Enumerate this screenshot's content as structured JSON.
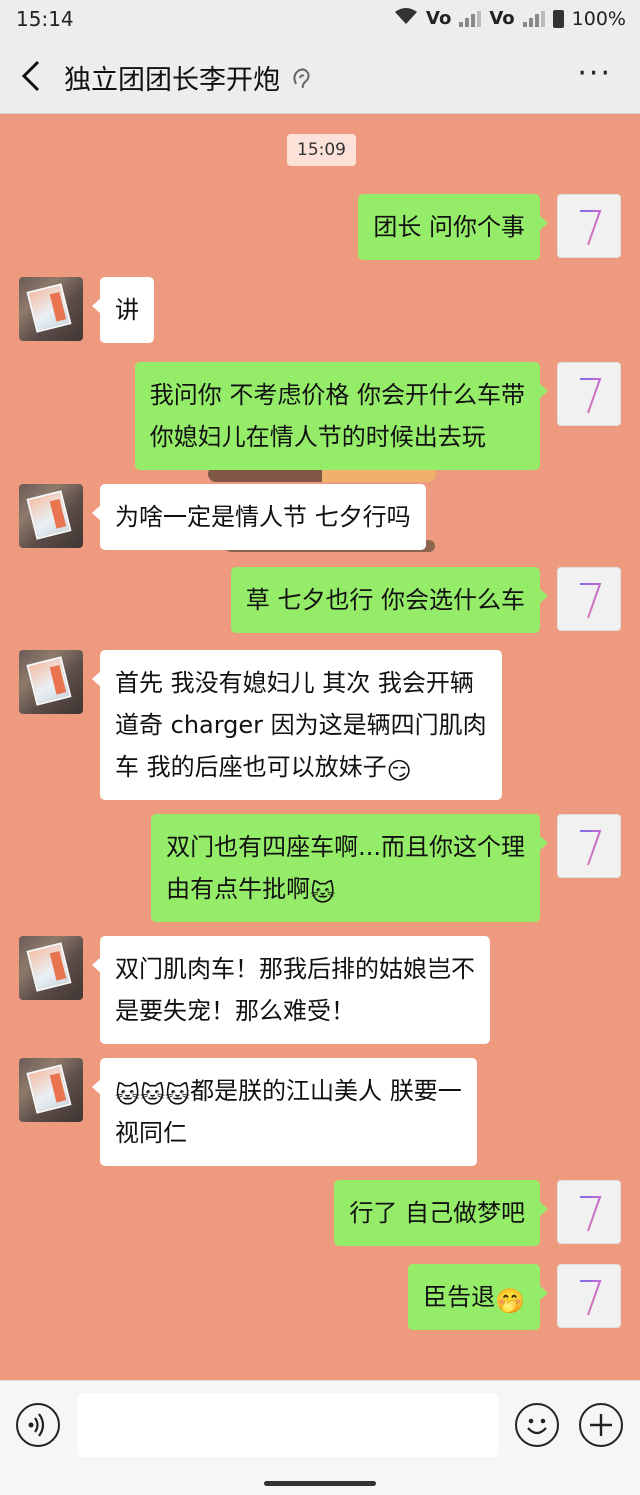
{
  "status_bar": {
    "time": "15:14",
    "signal1": "Vo",
    "signal2": "Vo",
    "battery": "100%"
  },
  "header": {
    "title": "独立团团长李开炮",
    "back_icon": "chevron-left-icon",
    "ear_icon": "ear-icon",
    "more_icon": "more-dots-icon",
    "more_label": "···"
  },
  "chat": {
    "timestamp": "15:09",
    "messages": [
      {
        "side": "right",
        "text": "团长 问你个事"
      },
      {
        "side": "left",
        "text": "讲"
      },
      {
        "side": "right",
        "line1": "我问你 不考虑价格 你会开什么车带",
        "line2": "你媳妇儿在情人节的时候出去玩"
      },
      {
        "side": "left",
        "text": "为啥一定是情人节 七夕行吗"
      },
      {
        "side": "right",
        "text": "草 七夕也行 你会选什么车"
      },
      {
        "side": "left",
        "line1": "首先 我没有媳妇儿 其次 我会开辆",
        "line2": "道奇 charger 因为这是辆四门肌肉",
        "line3": "车 我的后座也可以放妹子",
        "emoji": "😏"
      },
      {
        "side": "right",
        "line1": "双门也有四座车啊...而且你这个理",
        "line2": "由有点牛批啊",
        "emoji": "🐱"
      },
      {
        "side": "left",
        "line1": "双门肌肉车！那我后排的姑娘岂不",
        "line2": "是要失宠！那么难受！"
      },
      {
        "side": "left",
        "emoji": "🐱🐱🐱",
        "line1": "都是朕的江山美人 朕要一",
        "line2": "视同仁"
      },
      {
        "side": "right",
        "text": "行了 自己做梦吧"
      },
      {
        "side": "right",
        "text": "臣告退",
        "emoji": "🤭"
      }
    ]
  },
  "input_bar": {
    "voice_icon": "voice-icon",
    "emoji_icon": "emoji-icon",
    "plus_icon": "plus-icon",
    "input_value": ""
  },
  "colors": {
    "chat_background": "#ee9a7f",
    "bubble_self": "#95ec69",
    "bubble_other": "#ffffff",
    "bar_background": "#ededed"
  }
}
